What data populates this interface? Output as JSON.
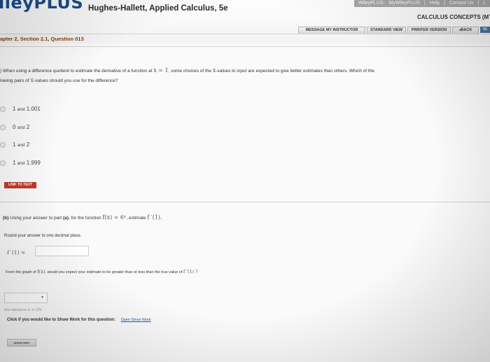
{
  "header": {
    "logo": "lleyPLUS",
    "book_title": "Hughes-Hallett, Applied Calculus, 5e",
    "wp_bar": [
      "WileyPLUS:",
      "MyWileyPLUS",
      "|",
      "Help",
      "|",
      "Contact Us",
      "|",
      "L"
    ],
    "course_name": "CALCULUS CONCEPTS (MTH",
    "nav_buttons": [
      "MESSAGE MY INSTRUCTOR",
      "STANDARD VIEW",
      "PRINTER VERSION",
      "◂BACK"
    ],
    "go_label": "NE"
  },
  "section_title": "apter 2, Section 2.1, Question 013",
  "question": {
    "prefix": ") When using a difference quotient to estimate the derivative of a function at",
    "x_eq": "x = 1",
    "mid": ", some choices of the",
    "x_var": "x",
    "suffix": "-values to input are expected to give better estimates than others. Which of the",
    "line2a": "lowing pairs of",
    "line2x": "x",
    "line2b": "-values should you use for the difference?"
  },
  "choices": [
    {
      "a": "1",
      "and": "and",
      "b": "1.001"
    },
    {
      "a": "0",
      "and": "and",
      "b": "2"
    },
    {
      "a": "1",
      "and": "and",
      "b": "2"
    },
    {
      "a": "1",
      "and": "and",
      "b": "1.999"
    }
  ],
  "link_to_text": "LINK TO TEXT",
  "part_b": {
    "label": "(b)",
    "text1": "Using your answer to part",
    "part_ref": "(a)",
    "text2": ", for the function",
    "func": "f(x) = 6ˣ",
    "text3": ", estimate",
    "estimate": "f ′(1).",
    "round": "Round your answer to one decimal place.",
    "fprime_label": "f ′(1) ="
  },
  "graph_question": {
    "text1": "From the graph of",
    "fx": "f(x)",
    "text2": ", would you expect your estimate to be greater than or less than the true value of",
    "fprime": "f ′(1) ?"
  },
  "tolerance": "the tolerance is +/-2%",
  "show_work": {
    "text": "Click if you would like to Show Work for this question:",
    "link": "Open Show Work"
  },
  "show_hint": "SHOW HINT"
}
